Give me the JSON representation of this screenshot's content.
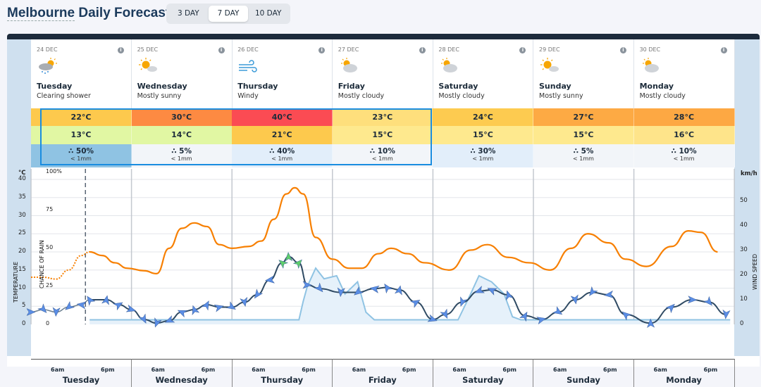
{
  "header": {
    "title_city": "Melbourne",
    "title_rest": "Daily Forecast",
    "toggle": [
      "3 DAY",
      "7 DAY",
      "10 DAY"
    ],
    "active_toggle": "7 DAY"
  },
  "days": [
    {
      "date": "24 DEC",
      "name": "Tuesday",
      "desc": "Clearing shower",
      "icon": "shower-sun-icon",
      "max": "22°C",
      "min": "13°C",
      "rain": "50%",
      "amount": "< 1mm",
      "max_color": "#fdc94d",
      "min_color": "#e1f7a3",
      "rain_color": "#8fc3e3"
    },
    {
      "date": "25 DEC",
      "name": "Wednesday",
      "desc": "Mostly sunny",
      "icon": "mostly-sunny-icon",
      "max": "30°C",
      "min": "14°C",
      "rain": "5%",
      "amount": "< 1mm",
      "max_color": "#fd8a42",
      "min_color": "#e1f7a3",
      "rain_color": "#f2f5f9"
    },
    {
      "date": "26 DEC",
      "name": "Thursday",
      "desc": "Windy",
      "icon": "wind-icon",
      "max": "40°C",
      "min": "21°C",
      "rain": "40%",
      "amount": "< 1mm",
      "max_color": "#fb4b53",
      "min_color": "#fdc94d",
      "rain_color": "#e2eefa"
    },
    {
      "date": "27 DEC",
      "name": "Friday",
      "desc": "Mostly cloudy",
      "icon": "mostly-cloudy-icon",
      "max": "23°C",
      "min": "15°C",
      "rain": "10%",
      "amount": "< 1mm",
      "max_color": "#fedf7c",
      "min_color": "#fee98e",
      "rain_color": "#f2f5f9"
    },
    {
      "date": "28 DEC",
      "name": "Saturday",
      "desc": "Mostly cloudy",
      "icon": "mostly-cloudy-icon",
      "max": "24°C",
      "min": "15°C",
      "rain": "30%",
      "amount": "< 1mm",
      "max_color": "#fdcb50",
      "min_color": "#fee98e",
      "rain_color": "#e2eefa"
    },
    {
      "date": "29 DEC",
      "name": "Sunday",
      "desc": "Mostly sunny",
      "icon": "mostly-sunny-icon",
      "max": "27°C",
      "min": "15°C",
      "rain": "5%",
      "amount": "< 1mm",
      "max_color": "#fdaa44",
      "min_color": "#fee98e",
      "rain_color": "#f2f5f9"
    },
    {
      "date": "30 DEC",
      "name": "Monday",
      "desc": "Mostly cloudy",
      "icon": "mostly-cloudy-icon",
      "max": "28°C",
      "min": "16°C",
      "rain": "10%",
      "amount": "< 1mm",
      "max_color": "#fda843",
      "min_color": "#fee48a",
      "rain_color": "#f2f5f9"
    }
  ],
  "chart_data": {
    "type": "line",
    "left_axis": {
      "unit": "°C",
      "label": "TEMPERATURE",
      "ticks": [
        0,
        5,
        10,
        15,
        20,
        25,
        30,
        35,
        40
      ],
      "range": [
        0,
        40
      ]
    },
    "rain_axis": {
      "label": "CHANCE OF RAIN",
      "ticks": [
        "0",
        "25",
        "50",
        "75",
        "100%"
      ],
      "range": [
        0,
        100
      ]
    },
    "right_axis": {
      "unit": "km/h",
      "label": "WIND SPEED",
      "ticks": [
        0,
        10,
        20,
        30,
        40,
        50
      ],
      "range": [
        0,
        60
      ]
    },
    "x_ticks": [
      "6am",
      "6pm"
    ],
    "now": "24 Dec 13:00",
    "colors": {
      "temperature": "#f77f00",
      "wind": "#2f4a63",
      "wind_arrow": "#5b8ee6",
      "rain": "#8fc3e3"
    },
    "temperature": [
      [
        "24 Dec 00:00",
        13
      ],
      [
        "24 Dec 03:00",
        13
      ],
      [
        "24 Dec 06:00",
        12.5
      ],
      [
        "24 Dec 09:00",
        15
      ],
      [
        "24 Dec 12:00",
        19
      ],
      [
        "24 Dec 14:00",
        20
      ],
      [
        "24 Dec 17:00",
        19
      ],
      [
        "24 Dec 20:00",
        17
      ],
      [
        "24 Dec 23:00",
        15.5
      ],
      [
        "25 Dec 03:00",
        14.8
      ],
      [
        "25 Dec 06:00",
        14
      ],
      [
        "25 Dec 09:00",
        21
      ],
      [
        "25 Dec 12:00",
        26.5
      ],
      [
        "25 Dec 15:00",
        28
      ],
      [
        "25 Dec 18:00",
        27
      ],
      [
        "25 Dec 21:00",
        22
      ],
      [
        "26 Dec 00:00",
        21
      ],
      [
        "26 Dec 04:00",
        21.5
      ],
      [
        "26 Dec 07:00",
        23
      ],
      [
        "26 Dec 10:00",
        29
      ],
      [
        "26 Dec 13:00",
        36
      ],
      [
        "26 Dec 15:00",
        37.7
      ],
      [
        "26 Dec 17:00",
        36
      ],
      [
        "26 Dec 20:00",
        24
      ],
      [
        "27 Dec 00:00",
        18
      ],
      [
        "27 Dec 04:00",
        15.5
      ],
      [
        "27 Dec 07:00",
        15.5
      ],
      [
        "27 Dec 11:00",
        19.5
      ],
      [
        "27 Dec 14:00",
        21
      ],
      [
        "27 Dec 18:00",
        19.5
      ],
      [
        "27 Dec 22:00",
        17
      ],
      [
        "28 Dec 04:00",
        15
      ],
      [
        "28 Dec 09:00",
        20.5
      ],
      [
        "28 Dec 13:00",
        22
      ],
      [
        "28 Dec 18:00",
        18.5
      ],
      [
        "28 Dec 23:00",
        17
      ],
      [
        "29 Dec 04:00",
        15
      ],
      [
        "29 Dec 09:00",
        21
      ],
      [
        "29 Dec 13:00",
        25
      ],
      [
        "29 Dec 18:00",
        22.5
      ],
      [
        "29 Dec 22:00",
        18
      ],
      [
        "30 Dec 03:00",
        16
      ],
      [
        "30 Dec 09:00",
        21.5
      ],
      [
        "30 Dec 13:00",
        25.8
      ],
      [
        "30 Dec 16:00",
        25.4
      ],
      [
        "30 Dec 20:00",
        20
      ]
    ],
    "wind": [
      [
        "24 Dec 00:00",
        5
      ],
      [
        "24 Dec 03:00",
        6
      ],
      [
        "24 Dec 06:00",
        5
      ],
      [
        "24 Dec 09:00",
        7
      ],
      [
        "24 Dec 12:00",
        8
      ],
      [
        "24 Dec 14:00",
        10
      ],
      [
        "24 Dec 18:00",
        10
      ],
      [
        "24 Dec 21:00",
        8
      ],
      [
        "25 Dec 00:00",
        6
      ],
      [
        "25 Dec 03:00",
        2
      ],
      [
        "25 Dec 06:00",
        0.5
      ],
      [
        "25 Dec 09:00",
        1.5
      ],
      [
        "25 Dec 12:00",
        5
      ],
      [
        "25 Dec 15:00",
        6
      ],
      [
        "25 Dec 18:00",
        8
      ],
      [
        "25 Dec 21:00",
        7
      ],
      [
        "26 Dec 00:00",
        7
      ],
      [
        "26 Dec 03:00",
        9
      ],
      [
        "26 Dec 06:00",
        12
      ],
      [
        "26 Dec 09:00",
        18
      ],
      [
        "26 Dec 12:00",
        25
      ],
      [
        "26 Dec 13:30",
        27.5
      ],
      [
        "26 Dec 16:00",
        25
      ],
      [
        "26 Dec 18:00",
        16
      ],
      [
        "26 Dec 21:00",
        14.5
      ],
      [
        "27 Dec 02:00",
        13
      ],
      [
        "27 Dec 06:00",
        13
      ],
      [
        "27 Dec 10:00",
        14.5
      ],
      [
        "27 Dec 13:00",
        15
      ],
      [
        "27 Dec 16:00",
        14
      ],
      [
        "27 Dec 20:00",
        9
      ],
      [
        "28 Dec 00:00",
        2
      ],
      [
        "28 Dec 03:00",
        4
      ],
      [
        "28 Dec 07:00",
        9
      ],
      [
        "28 Dec 11:00",
        13.5
      ],
      [
        "28 Dec 14:00",
        14
      ],
      [
        "28 Dec 18:00",
        12
      ],
      [
        "28 Dec 22:00",
        3.5
      ],
      [
        "29 Dec 02:00",
        2
      ],
      [
        "29 Dec 06:00",
        5
      ],
      [
        "29 Dec 10:00",
        10
      ],
      [
        "29 Dec 14:00",
        13
      ],
      [
        "29 Dec 18:00",
        12
      ],
      [
        "29 Dec 22:00",
        4
      ],
      [
        "30 Dec 04:00",
        0.5
      ],
      [
        "30 Dec 09:00",
        7
      ],
      [
        "30 Dec 14:00",
        10
      ],
      [
        "30 Dec 18:00",
        9
      ],
      [
        "30 Dec 22:00",
        4
      ]
    ],
    "rain_chance": [
      [
        "24 Dec 14:00",
        3
      ],
      [
        "26 Dec 16:00",
        3
      ],
      [
        "26 Dec 17:00",
        15
      ],
      [
        "26 Dec 18:00",
        25
      ],
      [
        "26 Dec 20:00",
        37
      ],
      [
        "26 Dec 22:00",
        30
      ],
      [
        "27 Dec 01:00",
        32
      ],
      [
        "27 Dec 03:00",
        20
      ],
      [
        "27 Dec 06:00",
        28
      ],
      [
        "27 Dec 08:00",
        8
      ],
      [
        "27 Dec 10:00",
        3
      ],
      [
        "28 Dec 06:00",
        3
      ],
      [
        "28 Dec 09:00",
        20
      ],
      [
        "28 Dec 11:00",
        32
      ],
      [
        "28 Dec 14:00",
        28
      ],
      [
        "28 Dec 17:00",
        20
      ],
      [
        "28 Dec 19:00",
        5
      ],
      [
        "28 Dec 21:00",
        3
      ],
      [
        "30 Dec 23:00",
        3
      ]
    ]
  }
}
